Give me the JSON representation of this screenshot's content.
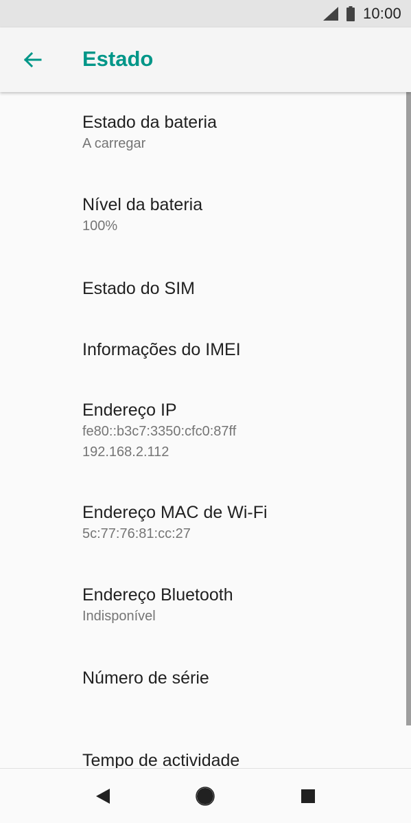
{
  "status_bar": {
    "time": "10:00"
  },
  "app_bar": {
    "title": "Estado"
  },
  "items": [
    {
      "title": "Estado da bateria",
      "summary": "A carregar"
    },
    {
      "title": "Nível da bateria",
      "summary": "100%"
    },
    {
      "title": "Estado do SIM"
    },
    {
      "title": "Informações do IMEI"
    },
    {
      "title": "Endereço IP",
      "summary_lines": [
        "fe80::b3c7:3350:cfc0:87ff",
        "192.168.2.112"
      ]
    },
    {
      "title": "Endereço MAC de Wi-Fi",
      "summary": "5c:77:76:81:cc:27"
    },
    {
      "title": "Endereço Bluetooth",
      "summary": "Indisponível"
    },
    {
      "title": "Número de série"
    },
    {
      "title": "Tempo de actividade"
    }
  ],
  "colors": {
    "accent": "#009688",
    "status_bar": "#e4e4e4",
    "background": "#fafafa"
  },
  "icons": {
    "back": "arrow-left-icon",
    "signal": "cellular-signal-icon",
    "battery": "battery-icon",
    "nav_back": "triangle-back-icon",
    "nav_home": "circle-home-icon",
    "nav_recents": "square-recents-icon"
  }
}
